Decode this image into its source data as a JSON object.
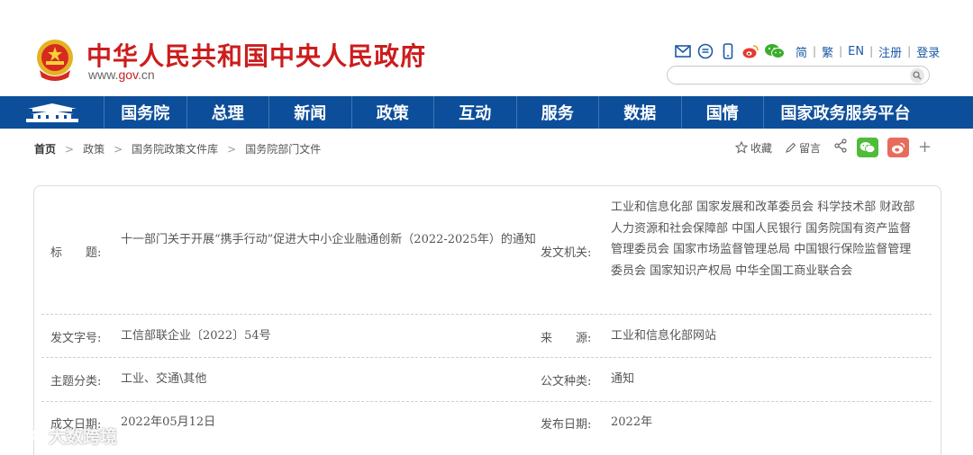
{
  "header": {
    "site_title": "中华人民共和国中央人民政府",
    "site_url_prefix": "www.",
    "site_url_brand": "gov",
    "site_url_suffix": ".cn",
    "links": [
      "简",
      "繁",
      "EN",
      "注册",
      "登录"
    ],
    "search_placeholder": ""
  },
  "nav": {
    "items": [
      "国务院",
      "总理",
      "新闻",
      "政策",
      "互动",
      "服务",
      "数据",
      "国情",
      "国家政务服务平台"
    ]
  },
  "breadcrumb": {
    "home": "首页",
    "items": [
      "政策",
      "国务院政策文件库",
      "国务院部门文件"
    ],
    "separator": ">"
  },
  "actions": {
    "favorite": "收藏",
    "comment": "留言",
    "more": "+"
  },
  "doc_info": {
    "title_label": "标　　题:",
    "title_value": "十一部门关于开展“携手行动”促进大中小企业融通创新（2022-2025年）的通知",
    "issuer_label": "发文机关:",
    "issuer_value": "工业和信息化部 国家发展和改革委员会 科学技术部 财政部 人力资源和社会保障部 中国人民银行 国务院国有资产监督管理委员会 国家市场监督管理总局 中国银行保险监督管理委员会 国家知识产权局 中华全国工商业联合会",
    "doc_no_label": "发文字号:",
    "doc_no_value": "工信部联企业〔2022〕54号",
    "source_label": "来　　源:",
    "source_value": "工业和信息化部网站",
    "topic_label": "主题分类:",
    "topic_value": "工业、交通\\其他",
    "type_label": "公文种类:",
    "type_value": "通知",
    "date_label": "成文日期:",
    "date_value": "2022年05月12日",
    "pub_label": "发布日期:",
    "pub_value": "2022年"
  },
  "watermark": {
    "text": "大数跨境"
  },
  "colors": {
    "brand_red": "#cc1d1d",
    "nav_blue": "#0d4e9a",
    "link_blue": "#1b5aa6",
    "wechat_green": "#4fbc3a",
    "weibo_red": "#e86b5b"
  }
}
